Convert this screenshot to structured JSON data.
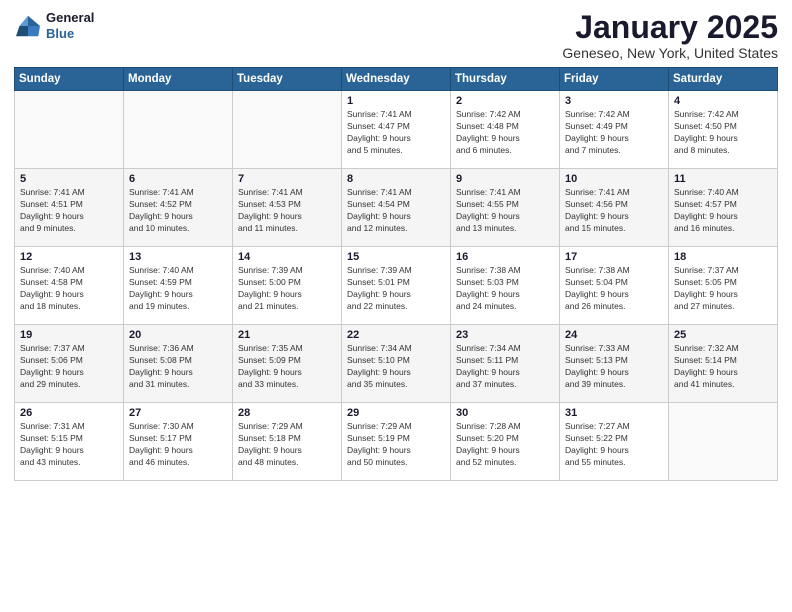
{
  "logo": {
    "line1": "General",
    "line2": "Blue"
  },
  "title": "January 2025",
  "location": "Geneseo, New York, United States",
  "days_of_week": [
    "Sunday",
    "Monday",
    "Tuesday",
    "Wednesday",
    "Thursday",
    "Friday",
    "Saturday"
  ],
  "weeks": [
    [
      {
        "day": "",
        "info": ""
      },
      {
        "day": "",
        "info": ""
      },
      {
        "day": "",
        "info": ""
      },
      {
        "day": "1",
        "info": "Sunrise: 7:41 AM\nSunset: 4:47 PM\nDaylight: 9 hours\nand 5 minutes."
      },
      {
        "day": "2",
        "info": "Sunrise: 7:42 AM\nSunset: 4:48 PM\nDaylight: 9 hours\nand 6 minutes."
      },
      {
        "day": "3",
        "info": "Sunrise: 7:42 AM\nSunset: 4:49 PM\nDaylight: 9 hours\nand 7 minutes."
      },
      {
        "day": "4",
        "info": "Sunrise: 7:42 AM\nSunset: 4:50 PM\nDaylight: 9 hours\nand 8 minutes."
      }
    ],
    [
      {
        "day": "5",
        "info": "Sunrise: 7:41 AM\nSunset: 4:51 PM\nDaylight: 9 hours\nand 9 minutes."
      },
      {
        "day": "6",
        "info": "Sunrise: 7:41 AM\nSunset: 4:52 PM\nDaylight: 9 hours\nand 10 minutes."
      },
      {
        "day": "7",
        "info": "Sunrise: 7:41 AM\nSunset: 4:53 PM\nDaylight: 9 hours\nand 11 minutes."
      },
      {
        "day": "8",
        "info": "Sunrise: 7:41 AM\nSunset: 4:54 PM\nDaylight: 9 hours\nand 12 minutes."
      },
      {
        "day": "9",
        "info": "Sunrise: 7:41 AM\nSunset: 4:55 PM\nDaylight: 9 hours\nand 13 minutes."
      },
      {
        "day": "10",
        "info": "Sunrise: 7:41 AM\nSunset: 4:56 PM\nDaylight: 9 hours\nand 15 minutes."
      },
      {
        "day": "11",
        "info": "Sunrise: 7:40 AM\nSunset: 4:57 PM\nDaylight: 9 hours\nand 16 minutes."
      }
    ],
    [
      {
        "day": "12",
        "info": "Sunrise: 7:40 AM\nSunset: 4:58 PM\nDaylight: 9 hours\nand 18 minutes."
      },
      {
        "day": "13",
        "info": "Sunrise: 7:40 AM\nSunset: 4:59 PM\nDaylight: 9 hours\nand 19 minutes."
      },
      {
        "day": "14",
        "info": "Sunrise: 7:39 AM\nSunset: 5:00 PM\nDaylight: 9 hours\nand 21 minutes."
      },
      {
        "day": "15",
        "info": "Sunrise: 7:39 AM\nSunset: 5:01 PM\nDaylight: 9 hours\nand 22 minutes."
      },
      {
        "day": "16",
        "info": "Sunrise: 7:38 AM\nSunset: 5:03 PM\nDaylight: 9 hours\nand 24 minutes."
      },
      {
        "day": "17",
        "info": "Sunrise: 7:38 AM\nSunset: 5:04 PM\nDaylight: 9 hours\nand 26 minutes."
      },
      {
        "day": "18",
        "info": "Sunrise: 7:37 AM\nSunset: 5:05 PM\nDaylight: 9 hours\nand 27 minutes."
      }
    ],
    [
      {
        "day": "19",
        "info": "Sunrise: 7:37 AM\nSunset: 5:06 PM\nDaylight: 9 hours\nand 29 minutes."
      },
      {
        "day": "20",
        "info": "Sunrise: 7:36 AM\nSunset: 5:08 PM\nDaylight: 9 hours\nand 31 minutes."
      },
      {
        "day": "21",
        "info": "Sunrise: 7:35 AM\nSunset: 5:09 PM\nDaylight: 9 hours\nand 33 minutes."
      },
      {
        "day": "22",
        "info": "Sunrise: 7:34 AM\nSunset: 5:10 PM\nDaylight: 9 hours\nand 35 minutes."
      },
      {
        "day": "23",
        "info": "Sunrise: 7:34 AM\nSunset: 5:11 PM\nDaylight: 9 hours\nand 37 minutes."
      },
      {
        "day": "24",
        "info": "Sunrise: 7:33 AM\nSunset: 5:13 PM\nDaylight: 9 hours\nand 39 minutes."
      },
      {
        "day": "25",
        "info": "Sunrise: 7:32 AM\nSunset: 5:14 PM\nDaylight: 9 hours\nand 41 minutes."
      }
    ],
    [
      {
        "day": "26",
        "info": "Sunrise: 7:31 AM\nSunset: 5:15 PM\nDaylight: 9 hours\nand 43 minutes."
      },
      {
        "day": "27",
        "info": "Sunrise: 7:30 AM\nSunset: 5:17 PM\nDaylight: 9 hours\nand 46 minutes."
      },
      {
        "day": "28",
        "info": "Sunrise: 7:29 AM\nSunset: 5:18 PM\nDaylight: 9 hours\nand 48 minutes."
      },
      {
        "day": "29",
        "info": "Sunrise: 7:29 AM\nSunset: 5:19 PM\nDaylight: 9 hours\nand 50 minutes."
      },
      {
        "day": "30",
        "info": "Sunrise: 7:28 AM\nSunset: 5:20 PM\nDaylight: 9 hours\nand 52 minutes."
      },
      {
        "day": "31",
        "info": "Sunrise: 7:27 AM\nSunset: 5:22 PM\nDaylight: 9 hours\nand 55 minutes."
      },
      {
        "day": "",
        "info": ""
      }
    ]
  ]
}
